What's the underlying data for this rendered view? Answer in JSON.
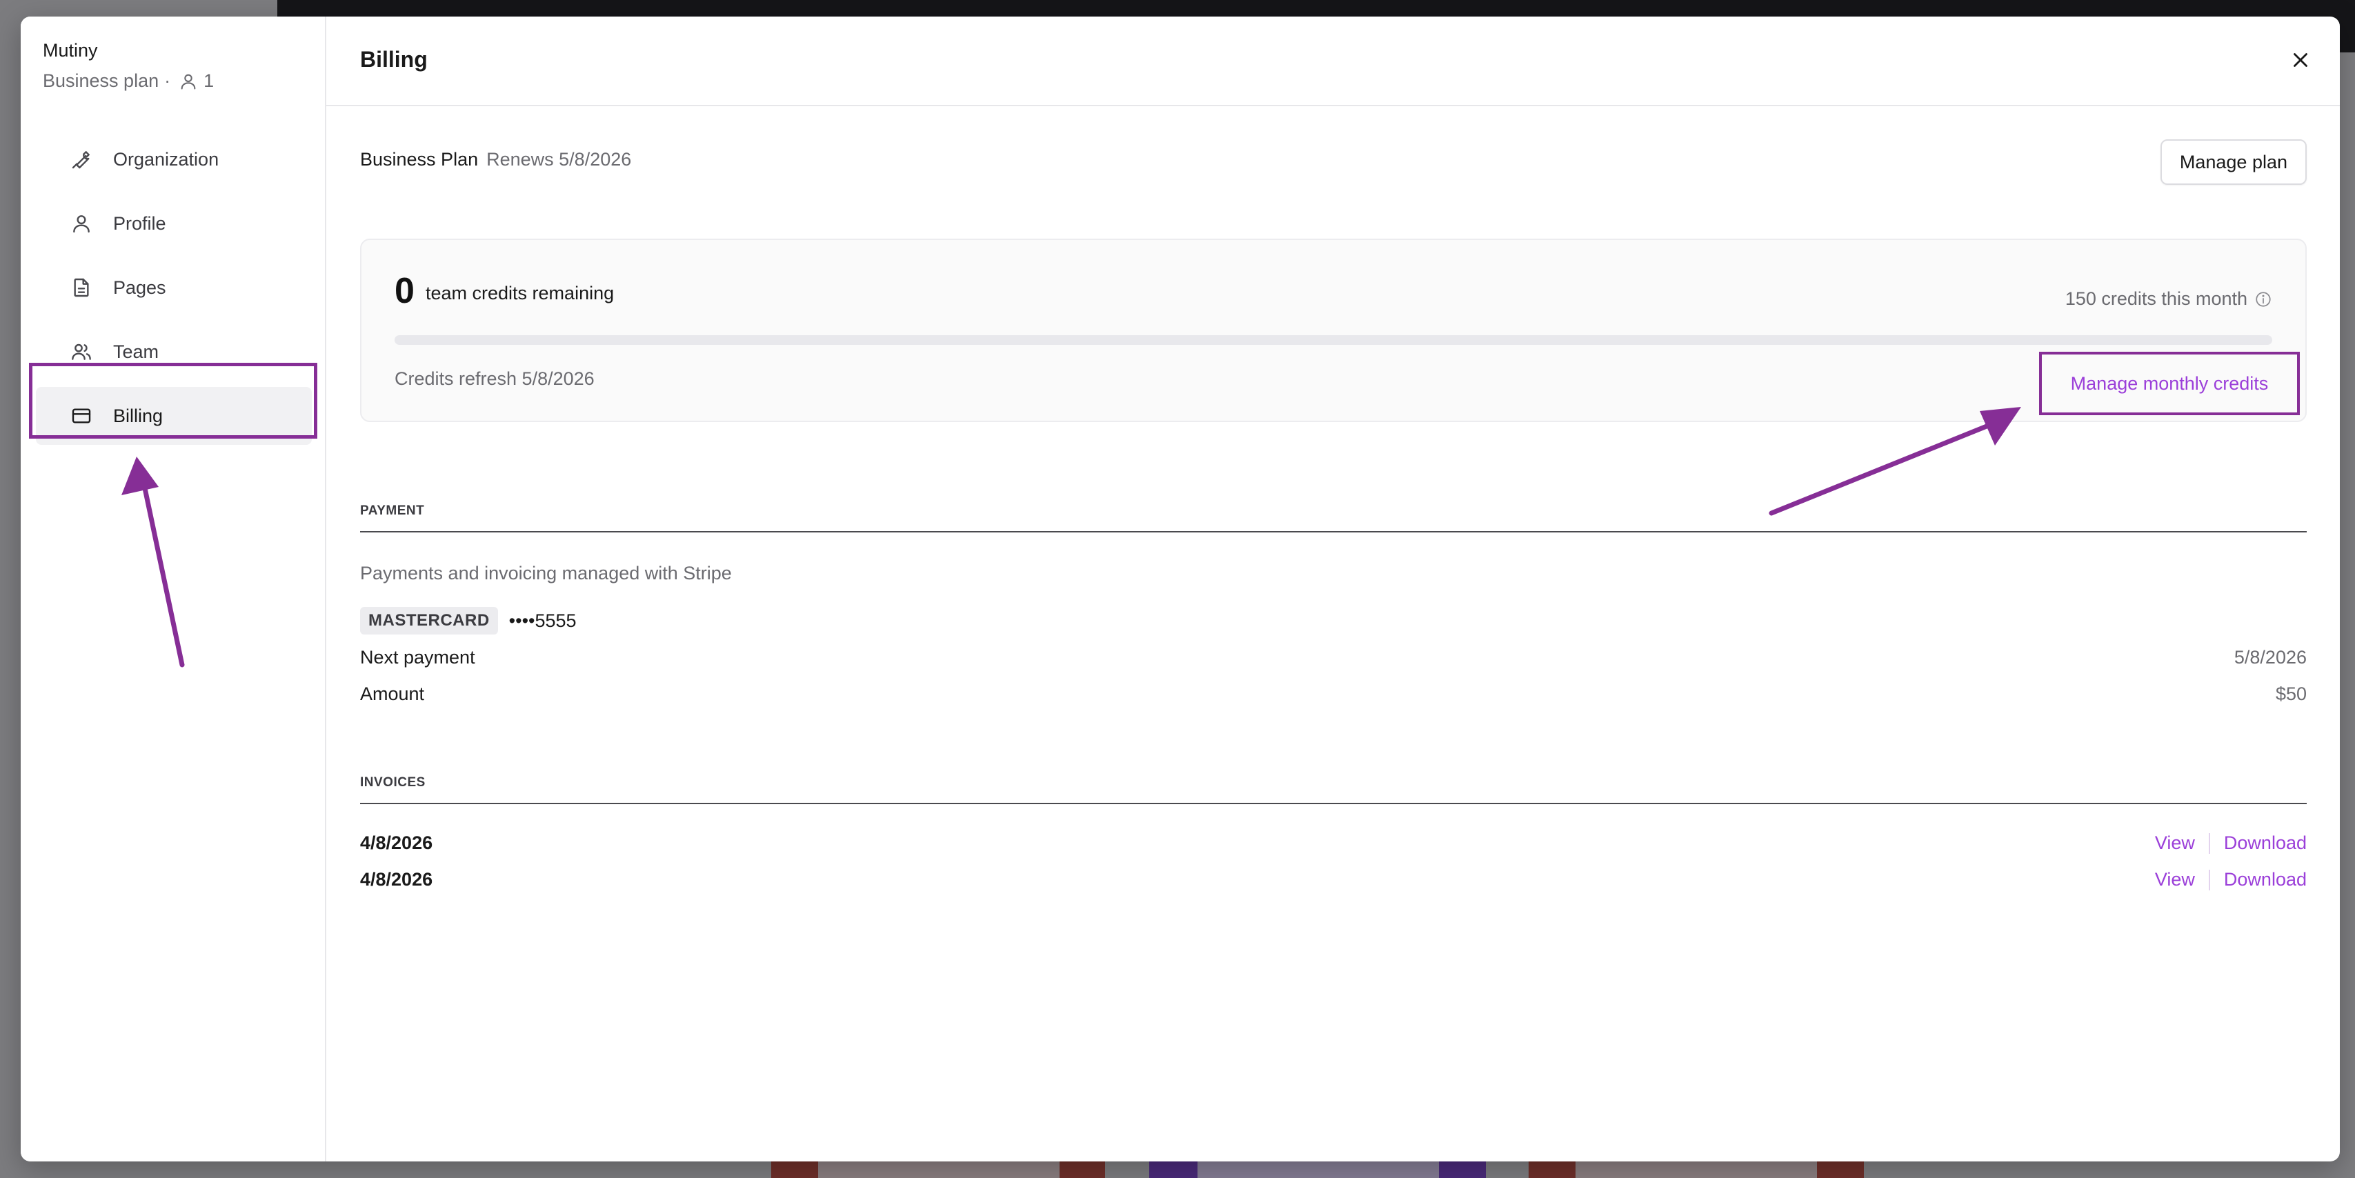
{
  "sidebar": {
    "org_name": "Mutiny",
    "plan_label": "Business plan",
    "separator": "·",
    "member_count": "1",
    "items": [
      {
        "label": "Organization",
        "icon": "wrench-icon",
        "active": false
      },
      {
        "label": "Profile",
        "icon": "user-icon",
        "active": false
      },
      {
        "label": "Pages",
        "icon": "document-icon",
        "active": false
      },
      {
        "label": "Team",
        "icon": "team-icon",
        "active": false
      },
      {
        "label": "Billing",
        "icon": "credit-card-icon",
        "active": true
      }
    ]
  },
  "header": {
    "title": "Billing",
    "close_icon": "close-icon"
  },
  "plan": {
    "name": "Business Plan",
    "renews": "Renews 5/8/2026",
    "manage_label": "Manage plan"
  },
  "credits": {
    "count": "0",
    "remaining_label": "team credits remaining",
    "monthly": "150 credits this month",
    "progress_fraction": 0,
    "refresh": "Credits refresh 5/8/2026",
    "manage_label": "Manage monthly credits"
  },
  "payment": {
    "section_title": "PAYMENT",
    "description": "Payments and invoicing managed with Stripe",
    "card_brand": "MASTERCARD",
    "card_number": "••••5555",
    "next_payment_label": "Next payment",
    "next_payment_value": "5/8/2026",
    "amount_label": "Amount",
    "amount_value": "$50"
  },
  "invoices": {
    "section_title": "INVOICES",
    "items": [
      {
        "date": "4/8/2026",
        "view_label": "View",
        "download_label": "Download"
      },
      {
        "date": "4/8/2026",
        "view_label": "View",
        "download_label": "Download"
      }
    ]
  },
  "colors": {
    "accent": "#9b3fd9",
    "annotation": "#862e96"
  }
}
